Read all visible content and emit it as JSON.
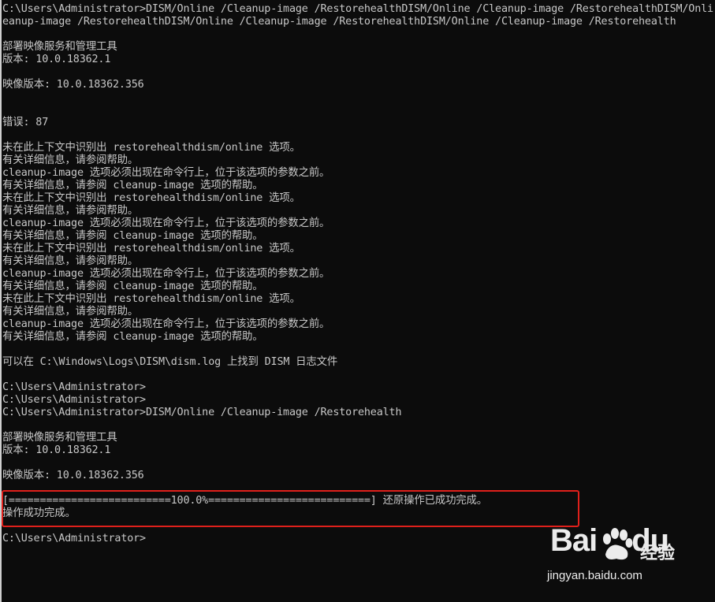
{
  "console": {
    "lines": [
      "C:\\Users\\Administrator>DISM/Online /Cleanup-image /RestorehealthDISM/Online /Cleanup-image /RestorehealthDISM/Onli",
      "eanup-image /RestorehealthDISM/Online /Cleanup-image /RestorehealthDISM/Online /Cleanup-image /Restorehealth",
      "",
      "部署映像服务和管理工具",
      "版本: 10.0.18362.1",
      "",
      "映像版本: 10.0.18362.356",
      "",
      "",
      "错误: 87",
      "",
      "未在此上下文中识别出 restorehealthdism/online 选项。",
      "有关详细信息，请参阅帮助。",
      "cleanup-image 选项必须出现在命令行上，位于该选项的参数之前。",
      "有关详细信息，请参阅 cleanup-image 选项的帮助。",
      "未在此上下文中识别出 restorehealthdism/online 选项。",
      "有关详细信息，请参阅帮助。",
      "cleanup-image 选项必须出现在命令行上，位于该选项的参数之前。",
      "有关详细信息，请参阅 cleanup-image 选项的帮助。",
      "未在此上下文中识别出 restorehealthdism/online 选项。",
      "有关详细信息，请参阅帮助。",
      "cleanup-image 选项必须出现在命令行上，位于该选项的参数之前。",
      "有关详细信息，请参阅 cleanup-image 选项的帮助。",
      "未在此上下文中识别出 restorehealthdism/online 选项。",
      "有关详细信息，请参阅帮助。",
      "cleanup-image 选项必须出现在命令行上，位于该选项的参数之前。",
      "有关详细信息，请参阅 cleanup-image 选项的帮助。",
      "",
      "可以在 C:\\Windows\\Logs\\DISM\\dism.log 上找到 DISM 日志文件",
      "",
      "C:\\Users\\Administrator>",
      "C:\\Users\\Administrator>",
      "C:\\Users\\Administrator>DISM/Online /Cleanup-image /Restorehealth",
      "",
      "部署映像服务和管理工具",
      "版本: 10.0.18362.1",
      "",
      "映像版本: 10.0.18362.356",
      "",
      "[==========================100.0%==========================] 还原操作已成功完成。",
      "操作成功完成。",
      "",
      "C:\\Users\\Administrator>"
    ]
  },
  "watermark": {
    "logo_text": "Bai",
    "logo_suffix": "du",
    "brand_cn": "经验",
    "url": "jingyan.baidu.com"
  },
  "colors": {
    "background": "#0c0c0c",
    "text": "#c8c8c8",
    "highlight_border": "#e0201b"
  }
}
